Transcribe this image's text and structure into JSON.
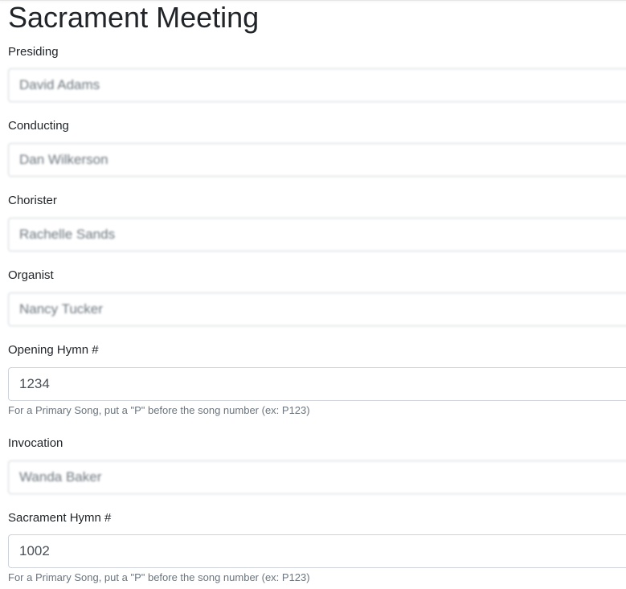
{
  "page": {
    "title": "Sacrament Meeting"
  },
  "fields": {
    "presiding": {
      "label": "Presiding",
      "value": "David Adams"
    },
    "conducting": {
      "label": "Conducting",
      "value": "Dan Wilkerson"
    },
    "chorister": {
      "label": "Chorister",
      "value": "Rachelle Sands"
    },
    "organist": {
      "label": "Organist",
      "value": "Nancy Tucker"
    },
    "opening_hymn": {
      "label": "Opening Hymn #",
      "value": "1234",
      "help": "For a Primary Song, put a \"P\" before the song number (ex: P123)"
    },
    "invocation": {
      "label": "Invocation",
      "value": "Wanda Baker"
    },
    "sacrament_hymn": {
      "label": "Sacrament Hymn #",
      "value": "1002",
      "help": "For a Primary Song, put a \"P\" before the song number (ex: P123)"
    }
  }
}
